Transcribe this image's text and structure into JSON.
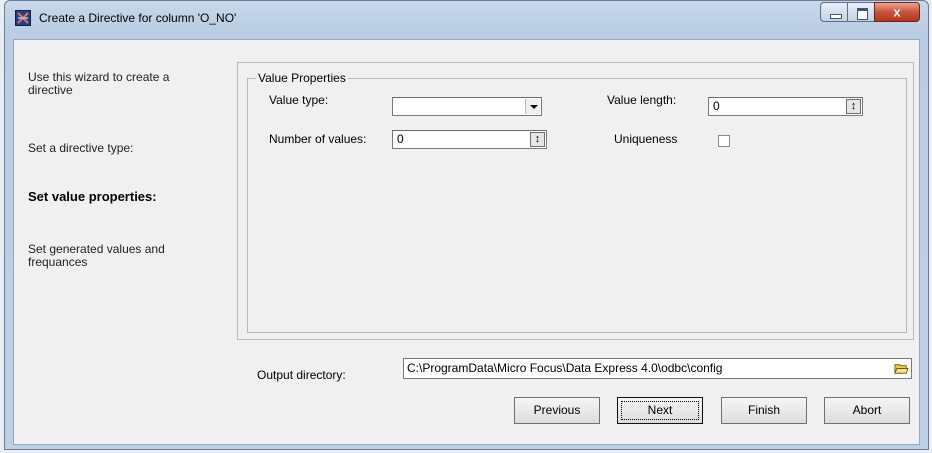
{
  "window": {
    "title": "Create a Directive for column 'O_NO'",
    "close_glyph": "x"
  },
  "sidebar": {
    "items": [
      {
        "label": "Use this wizard to create a directive"
      },
      {
        "label": "Set a directive type:"
      },
      {
        "label": "Set value properties:"
      },
      {
        "label": "Set generated values and frequances"
      }
    ]
  },
  "value_properties": {
    "group_title": "Value Properties",
    "value_type_label": "Value type:",
    "value_type_value": "",
    "number_of_values_label": "Number of values:",
    "number_of_values_value": "0",
    "value_length_label": "Value length:",
    "value_length_value": "0",
    "uniqueness_label": "Uniqueness",
    "uniqueness_checked": false
  },
  "output": {
    "label": "Output directory:",
    "path": "C:\\ProgramData\\Micro Focus\\Data Express 4.0\\odbc\\config"
  },
  "buttons": {
    "previous": "Previous",
    "next": "Next",
    "finish": "Finish",
    "abort": "Abort"
  },
  "icons": {
    "spin": "spinner-arrows-icon",
    "folder": "folder-open-icon",
    "app": "app-icon"
  }
}
